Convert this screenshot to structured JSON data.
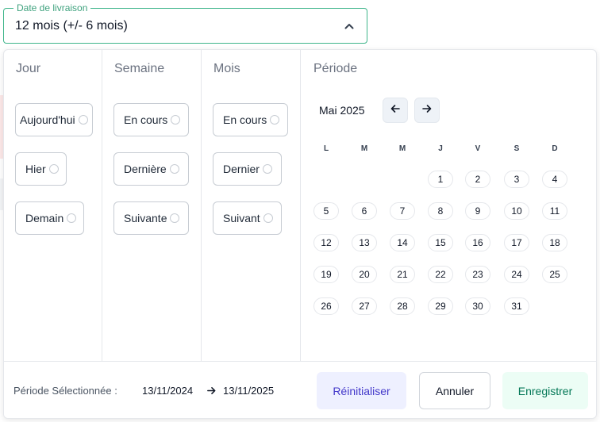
{
  "field": {
    "legend": "Date de livraison",
    "value": "12 mois (+/- 6 mois)"
  },
  "columns": {
    "day": {
      "title": "Jour",
      "options": [
        "Aujourd'hui",
        "Hier",
        "Demain"
      ]
    },
    "week": {
      "title": "Semaine",
      "options": [
        "En cours",
        "Dernière",
        "Suivante"
      ]
    },
    "month": {
      "title": "Mois",
      "options": [
        "En cours",
        "Dernier",
        "Suivant"
      ]
    },
    "period": {
      "title": "Période"
    }
  },
  "calendar": {
    "month_label": "Mai 2025",
    "weekdays": [
      "L",
      "M",
      "M",
      "J",
      "V",
      "S",
      "D"
    ],
    "days": [
      "1",
      "2",
      "3",
      "4",
      "5",
      "6",
      "7",
      "8",
      "9",
      "10",
      "11",
      "12",
      "13",
      "14",
      "15",
      "16",
      "17",
      "18",
      "19",
      "20",
      "21",
      "22",
      "23",
      "24",
      "25",
      "26",
      "27",
      "28",
      "29",
      "30",
      "31"
    ]
  },
  "footer": {
    "period_label": "Période Sélectionnée :",
    "start_date": "13/11/2024",
    "end_date": "13/11/2025",
    "reset_label": "Réinitialiser",
    "cancel_label": "Annuler",
    "save_label": "Enregistrer"
  },
  "colors": {
    "accent_green": "#3fb58b",
    "reset_bg": "#eef0ff",
    "save_bg": "#ecfdf5"
  },
  "icons": {
    "field_toggle": "chevron-up-icon",
    "prev_month": "arrow-left-icon",
    "next_month": "arrow-right-icon",
    "period_separator": "arrow-right-icon",
    "option_indicator": "radio-icon"
  }
}
